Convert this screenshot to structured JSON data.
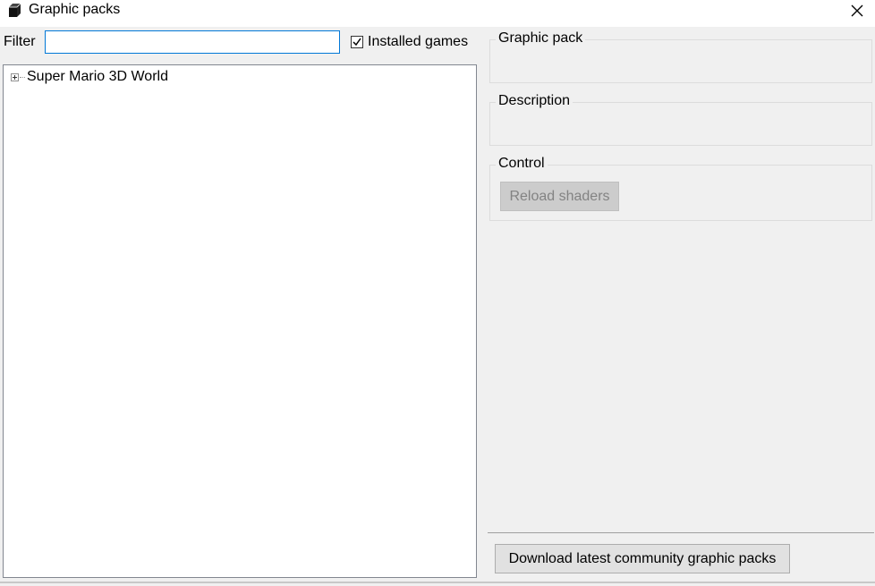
{
  "window": {
    "title": "Graphic packs",
    "app_icon": "package-cube-icon",
    "close_icon": "close-icon"
  },
  "filter": {
    "label": "Filter",
    "value": "",
    "placeholder": ""
  },
  "installed_games": {
    "label": "Installed games",
    "checked": true
  },
  "tree": {
    "items": [
      {
        "label": "Super Mario 3D World",
        "expanded": false
      }
    ]
  },
  "details": {
    "graphic_pack_title": "Graphic pack",
    "description_title": "Description",
    "control_title": "Control",
    "reload_label": "Reload shaders",
    "reload_enabled": false
  },
  "footer": {
    "download_label": "Download latest community graphic packs"
  }
}
